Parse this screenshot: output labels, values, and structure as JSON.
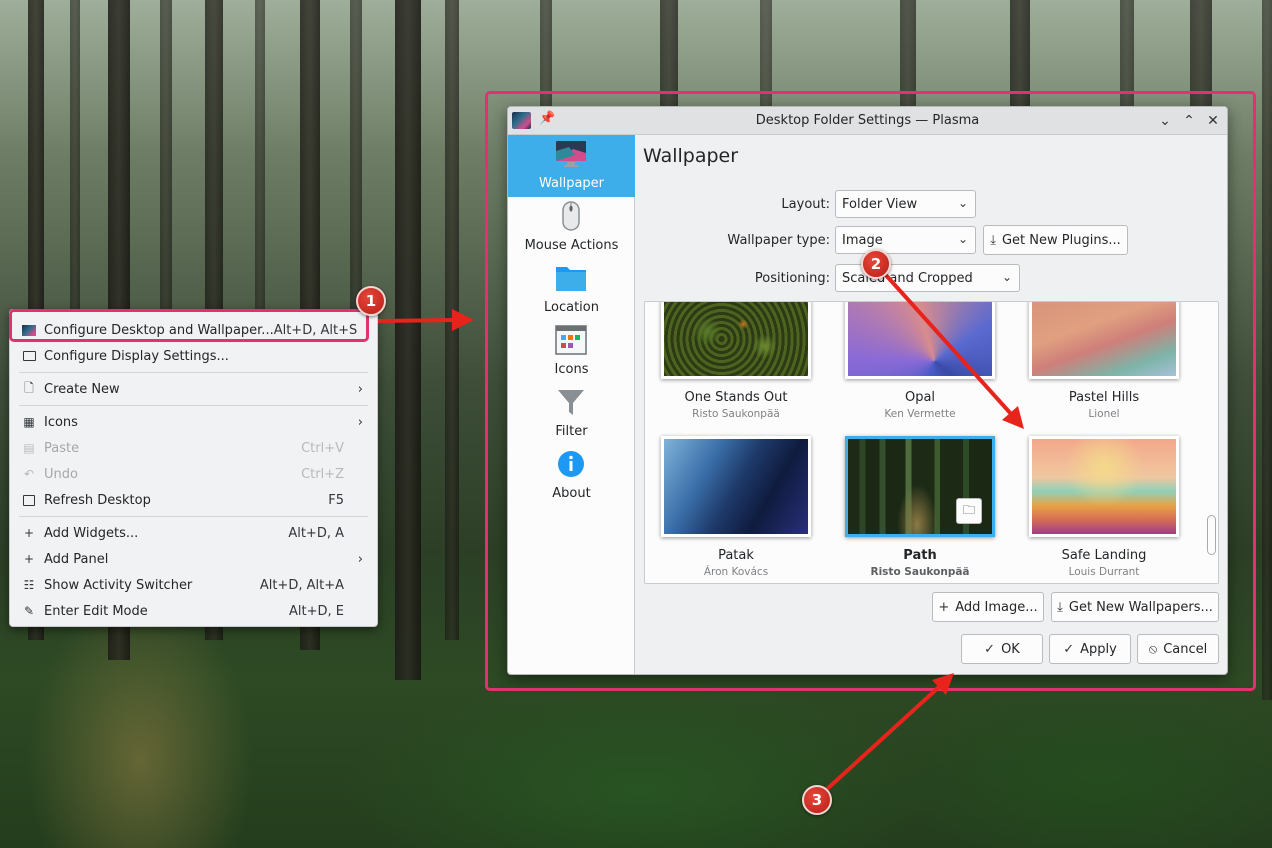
{
  "context_menu": {
    "items": [
      {
        "label": "Configure Desktop and Wallpaper...",
        "shortcut": "Alt+D, Alt+S",
        "icon": "wallpaper-icon"
      },
      {
        "label": "Configure Display Settings...",
        "shortcut": "",
        "icon": "monitor-icon"
      },
      {
        "label": "Create New",
        "shortcut": "",
        "icon": "new-document-icon",
        "submenu": true
      },
      {
        "label": "Icons",
        "shortcut": "",
        "icon": "grid-icon",
        "submenu": true
      },
      {
        "label": "Paste",
        "shortcut": "Ctrl+V",
        "icon": "paste-icon",
        "disabled": true
      },
      {
        "label": "Undo",
        "shortcut": "Ctrl+Z",
        "icon": "undo-icon",
        "disabled": true
      },
      {
        "label": "Refresh Desktop",
        "shortcut": "F5",
        "icon": "refresh-icon"
      },
      {
        "label": "Add Widgets...",
        "shortcut": "Alt+D, A",
        "icon": "plus-icon"
      },
      {
        "label": "Add Panel",
        "shortcut": "",
        "icon": "plus-icon",
        "submenu": true
      },
      {
        "label": "Show Activity Switcher",
        "shortcut": "Alt+D, Alt+A",
        "icon": "activities-icon"
      },
      {
        "label": "Enter Edit Mode",
        "shortcut": "Alt+D, E",
        "icon": "pencil-icon"
      }
    ]
  },
  "annotations": {
    "step1": "1",
    "step2": "2",
    "step3": "3",
    "accent": "#e0326e"
  },
  "dialog": {
    "title": "Desktop Folder Settings — Plasma",
    "sidebar": [
      {
        "label": "Wallpaper",
        "icon": "monitor-icon",
        "active": true
      },
      {
        "label": "Mouse Actions",
        "icon": "mouse-icon"
      },
      {
        "label": "Location",
        "icon": "folder-icon"
      },
      {
        "label": "Icons",
        "icon": "icons-icon"
      },
      {
        "label": "Filter",
        "icon": "filter-icon"
      },
      {
        "label": "About",
        "icon": "info-icon"
      }
    ],
    "page_title": "Wallpaper",
    "layout_label": "Layout:",
    "layout_value": "Folder View",
    "wallpaper_type_label": "Wallpaper type:",
    "wallpaper_type_value": "Image",
    "get_plugins_label": "Get New Plugins...",
    "positioning_label": "Positioning:",
    "positioning_value": "Scaled and Cropped",
    "wallpapers": [
      {
        "name": "One Stands Out",
        "author": "Risto Saukonpää"
      },
      {
        "name": "Opal",
        "author": "Ken Vermette"
      },
      {
        "name": "Pastel Hills",
        "author": "Lionel"
      },
      {
        "name": "Patak",
        "author": "Áron Kovács"
      },
      {
        "name": "Path",
        "author": "Risto Saukonpää",
        "selected": true
      },
      {
        "name": "Safe Landing",
        "author": "Louis Durrant"
      }
    ],
    "add_image_label": "Add Image...",
    "get_wallpapers_label": "Get New Wallpapers...",
    "ok_label": "OK",
    "apply_label": "Apply",
    "cancel_label": "Cancel",
    "accent": "#3daee9"
  }
}
